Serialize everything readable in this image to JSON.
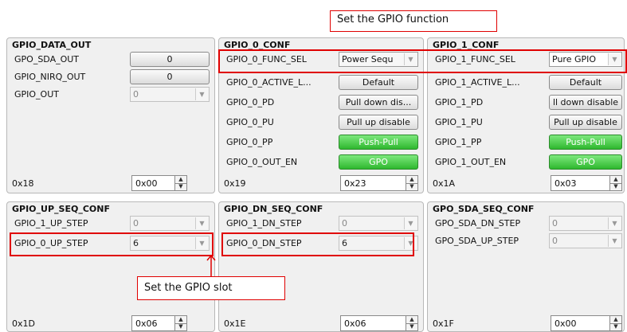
{
  "panels": {
    "gpio_data_out": {
      "title": "GPIO_DATA_OUT",
      "rows": [
        {
          "label": "GPO_SDA_OUT",
          "value": "0"
        },
        {
          "label": "GPIO_NIRQ_OUT",
          "value": "0"
        },
        {
          "label": "GPIO_OUT",
          "value": "0"
        }
      ],
      "addr": "0x18",
      "reg": "0x00"
    },
    "gpio_0_conf": {
      "title": "GPIO_0_CONF",
      "rows": [
        {
          "label": "GPIO_0_FUNC_SEL",
          "value": "Power Sequ"
        },
        {
          "label": "GPIO_0_ACTIVE_L...",
          "value": "Default"
        },
        {
          "label": "GPIO_0_PD",
          "value": "Pull down dis..."
        },
        {
          "label": "GPIO_0_PU",
          "value": "Pull up disable"
        },
        {
          "label": "GPIO_0_PP",
          "value": "Push-Pull"
        },
        {
          "label": "GPIO_0_OUT_EN",
          "value": "GPO"
        }
      ],
      "addr": "0x19",
      "reg": "0x23"
    },
    "gpio_1_conf": {
      "title": "GPIO_1_CONF",
      "rows": [
        {
          "label": "GPIO_1_FUNC_SEL",
          "value": "Pure GPIO"
        },
        {
          "label": "GPIO_1_ACTIVE_L...",
          "value": "Default"
        },
        {
          "label": "GPIO_1_PD",
          "value": "ll down disable"
        },
        {
          "label": "GPIO_1_PU",
          "value": "Pull up disable"
        },
        {
          "label": "GPIO_1_PP",
          "value": "Push-Pull"
        },
        {
          "label": "GPIO_1_OUT_EN",
          "value": "GPO"
        }
      ],
      "addr": "0x1A",
      "reg": "0x03"
    },
    "gpio_up_seq_conf": {
      "title": "GPIO_UP_SEQ_CONF",
      "rows": [
        {
          "label": "GPIO_1_UP_STEP",
          "value": "0"
        },
        {
          "label": "GPIO_0_UP_STEP",
          "value": "6"
        }
      ],
      "addr": "0x1D",
      "reg": "0x06"
    },
    "gpio_dn_seq_conf": {
      "title": "GPIO_DN_SEQ_CONF",
      "rows": [
        {
          "label": "GPIO_1_DN_STEP",
          "value": "0"
        },
        {
          "label": "GPIO_0_DN_STEP",
          "value": "6"
        }
      ],
      "addr": "0x1E",
      "reg": "0x06"
    },
    "gpo_sda_seq_conf": {
      "title": "GPO_SDA_SEQ_CONF",
      "rows": [
        {
          "label": "GPO_SDA_DN_STEP",
          "value": "0"
        },
        {
          "label": "GPO_SDA_UP_STEP",
          "value": "0"
        }
      ],
      "addr": "0x1F",
      "reg": "0x00"
    }
  },
  "annotations": {
    "function_callout": "Set the GPIO function",
    "slot_callout": "Set the GPIO slot"
  },
  "colors": {
    "highlight": "#e00000",
    "green_button": "#3cc43c"
  }
}
